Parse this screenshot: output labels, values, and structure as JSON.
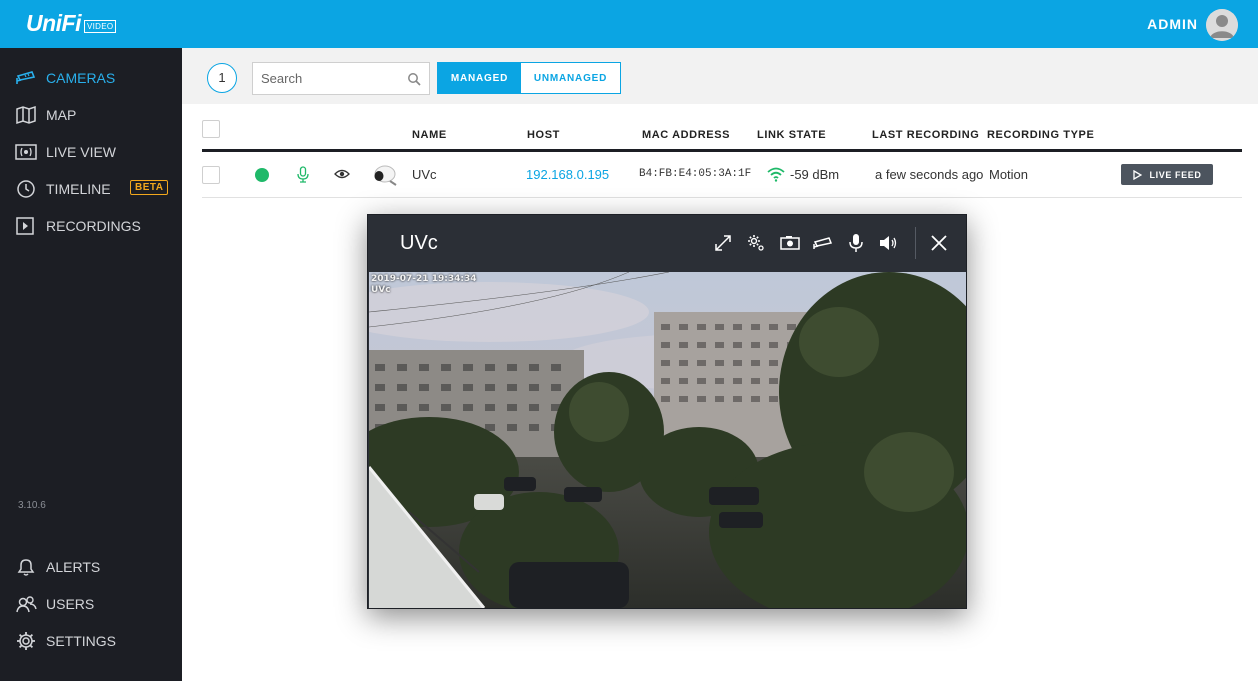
{
  "app": {
    "logo_text": "UniFi",
    "logo_badge": "VIDEO",
    "user_label": "ADMIN",
    "version": "3.10.6"
  },
  "sidebar": {
    "items": [
      {
        "label": "CAMERAS",
        "icon": "camera-icon",
        "active": true
      },
      {
        "label": "MAP",
        "icon": "map-icon"
      },
      {
        "label": "LIVE VIEW",
        "icon": "live-view-icon"
      },
      {
        "label": "TIMELINE",
        "icon": "clock-icon",
        "badge": "BETA"
      },
      {
        "label": "RECORDINGS",
        "icon": "play-square-icon"
      }
    ],
    "bottom_items": [
      {
        "label": "ALERTS",
        "icon": "bell-icon"
      },
      {
        "label": "USERS",
        "icon": "users-icon"
      },
      {
        "label": "SETTINGS",
        "icon": "gear-icon"
      }
    ]
  },
  "toolbar": {
    "count": "1",
    "search_placeholder": "Search",
    "managed_label": "MANAGED",
    "unmanaged_label": "UNMANAGED"
  },
  "table": {
    "headers": {
      "name": "NAME",
      "host": "HOST",
      "mac": "MAC ADDRESS",
      "link": "LINK STATE",
      "last": "LAST RECORDING",
      "type": "RECORDING TYPE"
    },
    "rows": [
      {
        "name": "UVc",
        "host": "192.168.0.195",
        "mac": "B4:FB:E4:05:3A:1F",
        "link_state": "-59 dBm",
        "last_recording": "a few seconds ago",
        "recording_type": "Motion",
        "action_label": "LIVE FEED",
        "status_color": "#1fb969"
      }
    ]
  },
  "modal": {
    "title": "UVc",
    "overlay_timestamp": "2019-07-21 19:34:34",
    "overlay_name": "UVc"
  },
  "colors": {
    "brand": "#0ba5e3",
    "sidebar_bg": "#1c1e24",
    "beta": "#f2a81d",
    "online": "#1fb969"
  }
}
